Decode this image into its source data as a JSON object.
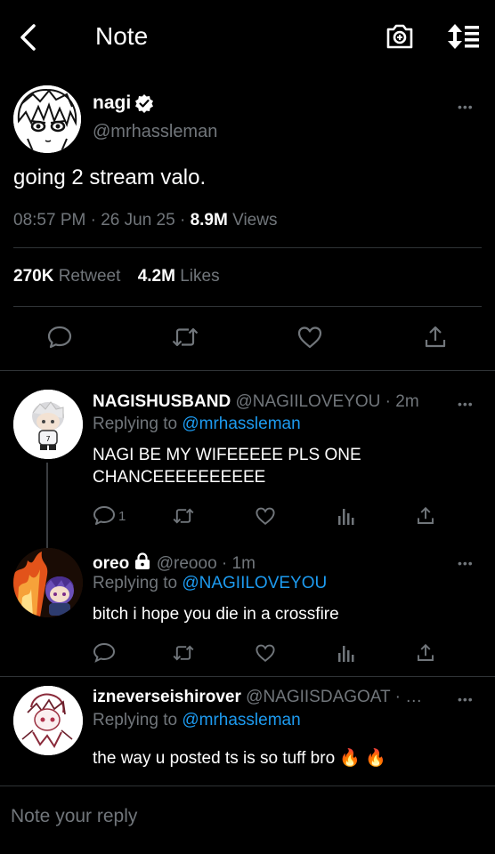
{
  "header": {
    "title": "Note"
  },
  "tweet": {
    "name": "nagi",
    "handle": "@mrhassleman",
    "text": "going 2 stream valo.",
    "time": "08:57 PM",
    "date": "26 Jun 25",
    "views_count": "8.9M",
    "views_label": "Views",
    "retweets_count": "270K",
    "retweets_label": "Retweet",
    "likes_count": "4.2M",
    "likes_label": "Likes"
  },
  "replies": [
    {
      "name": "NAGISHUSBAND",
      "handle": "@NAGIILOVEYOU",
      "time": "· 2m",
      "replying_prefix": "Replying to",
      "replying_to": "@mrhassleman",
      "text": "NAGI BE MY WIFEEEEE PLS ONE CHANCEEEEEEEEEE",
      "reply_count": "1"
    },
    {
      "name": "oreo",
      "handle": "@reooo",
      "time": "· 1m",
      "replying_prefix": "Replying to",
      "replying_to": "@NAGIILOVEYOU",
      "text": "bitch i hope you die in a crossfire"
    },
    {
      "name": "izneverseishirover",
      "handle": "@NAGIISDAGOAT",
      "time": "· …",
      "replying_prefix": "Replying to",
      "replying_to": "@mrhassleman",
      "text": "the way u posted ts is so tuff bro 🔥 🔥"
    }
  ],
  "compose": {
    "placeholder": "Note your reply"
  },
  "colors": {
    "background": "#000000",
    "accent": "#1d9bf0",
    "secondary_text": "#71767b",
    "divider": "#2f3336"
  }
}
